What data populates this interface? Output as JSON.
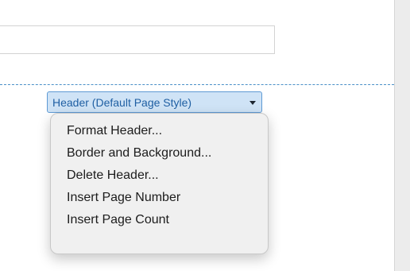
{
  "header_tab": {
    "label": "Header (Default Page Style)",
    "arrow_icon": "chevron-down-icon"
  },
  "context_menu": {
    "items": [
      {
        "label": "Format Header..."
      },
      {
        "label": "Border and Background..."
      },
      {
        "label": "Delete Header..."
      },
      {
        "label": "Insert Page Number"
      },
      {
        "label": "Insert Page Count"
      }
    ]
  },
  "colors": {
    "header_line": "#4a90c8",
    "header_tab_bg": "#cfe3f6",
    "header_tab_text": "#1f5fa3",
    "menu_bg": "#f0f0f0"
  }
}
